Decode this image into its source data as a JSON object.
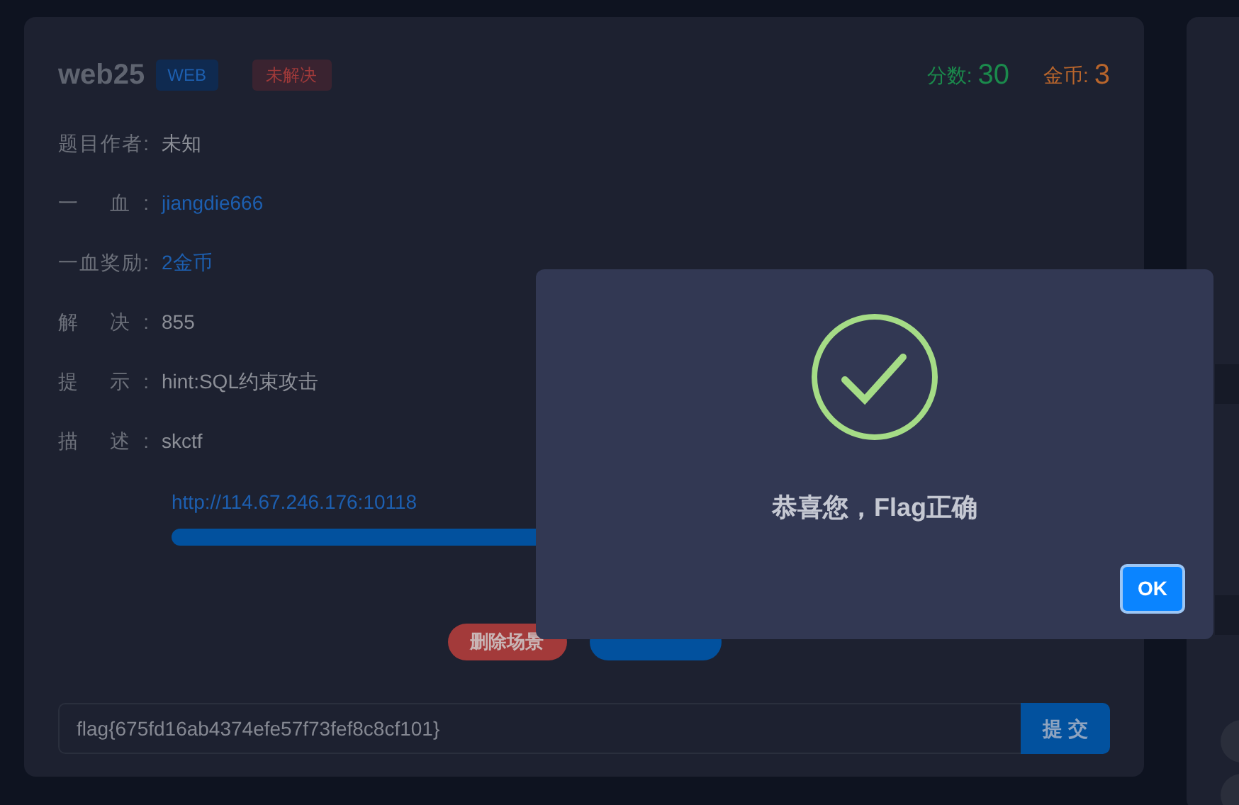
{
  "challenge": {
    "title": "web25",
    "category": "WEB",
    "status": "未解决",
    "score_label": "分数:",
    "score": "30",
    "coins_label": "金币:",
    "coins": "3",
    "fields": [
      {
        "label": "题目作者:",
        "value": "未知",
        "kind": "text"
      },
      {
        "label": "一 血:",
        "value": "jiangdie666",
        "kind": "link"
      },
      {
        "label": "一血奖励:",
        "value": "2金币",
        "kind": "link"
      },
      {
        "label": "解 决:",
        "value": "855",
        "kind": "text"
      },
      {
        "label": "提 示:",
        "value": "hint:SQL约束攻击",
        "kind": "text"
      },
      {
        "label": "描 述:",
        "value": "skctf",
        "kind": "text"
      }
    ],
    "url": "http://114.67.246.176:10118",
    "buttons": [
      {
        "label": "删除场景",
        "kind": "danger"
      },
      {
        "kind": "primary"
      }
    ],
    "flag_input": {
      "value": "flag{675fd16ab4374efe57f73fef8c8cf101}"
    },
    "submit": "提 交"
  },
  "dialog": {
    "message": "恭喜您，Flag正确",
    "button": "OK"
  }
}
